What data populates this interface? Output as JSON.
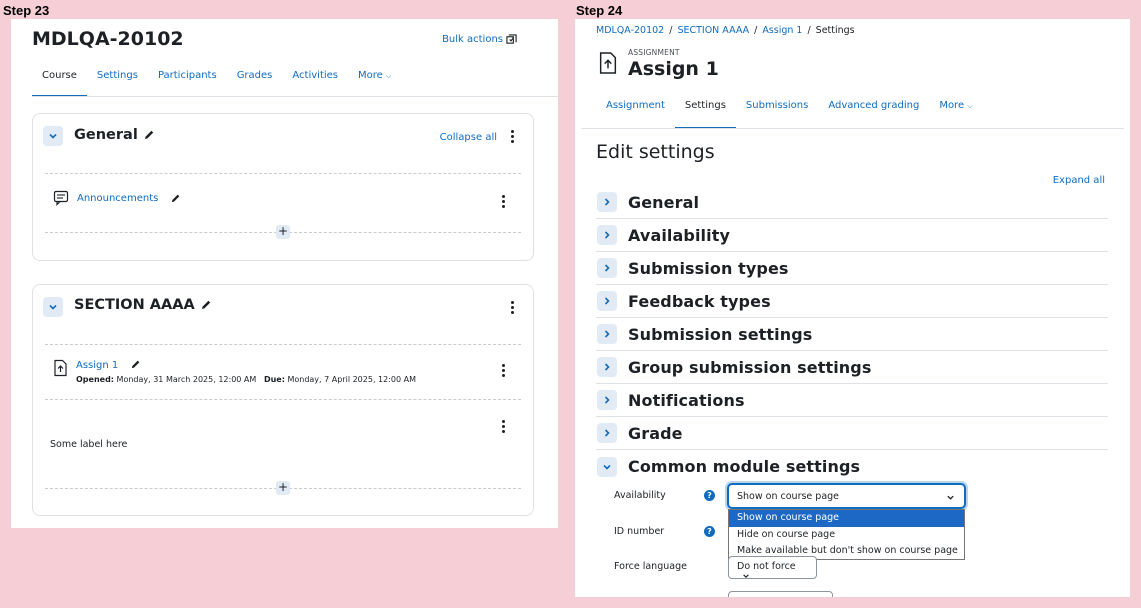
{
  "steps": {
    "left": "Step 23",
    "right": "Step 24"
  },
  "left": {
    "course_title": "MDLQA-20102",
    "bulk_actions": "Bulk actions",
    "tabs": [
      {
        "label": "Course",
        "active": true
      },
      {
        "label": "Settings",
        "active": false
      },
      {
        "label": "Participants",
        "active": false
      },
      {
        "label": "Grades",
        "active": false
      },
      {
        "label": "Activities",
        "active": false
      },
      {
        "label": "More",
        "active": false
      }
    ],
    "sections": [
      {
        "title": "General",
        "collapse_all": "Collapse all",
        "activities": [
          {
            "name": "Announcements",
            "icon": "forum-icon"
          }
        ]
      },
      {
        "title": "SECTION AAAA",
        "activities": [
          {
            "name": "Assign 1",
            "icon": "assignment-icon",
            "opened_label": "Opened:",
            "opened_value": "Monday, 31 March 2025, 12:00 AM",
            "due_label": "Due:",
            "due_value": "Monday, 7 April 2025, 12:00 AM"
          }
        ],
        "label_text": "Some label here"
      }
    ]
  },
  "right": {
    "breadcrumb": [
      "MDLQA-20102",
      "SECTION AAAA",
      "Assign 1",
      "Settings"
    ],
    "activity_kind": "ASSIGNMENT",
    "activity_title": "Assign 1",
    "tabs": [
      {
        "label": "Assignment",
        "active": false
      },
      {
        "label": "Settings",
        "active": true
      },
      {
        "label": "Submissions",
        "active": false
      },
      {
        "label": "Advanced grading",
        "active": false
      },
      {
        "label": "More",
        "active": false
      }
    ],
    "edit_title": "Edit settings",
    "expand_all": "Expand all",
    "fieldsets": [
      {
        "label": "General",
        "expanded": false
      },
      {
        "label": "Availability",
        "expanded": false
      },
      {
        "label": "Submission types",
        "expanded": false
      },
      {
        "label": "Feedback types",
        "expanded": false
      },
      {
        "label": "Submission settings",
        "expanded": false
      },
      {
        "label": "Group submission settings",
        "expanded": false
      },
      {
        "label": "Notifications",
        "expanded": false
      },
      {
        "label": "Grade",
        "expanded": false
      },
      {
        "label": "Common module settings",
        "expanded": true
      }
    ],
    "form": {
      "availability_label": "Availability",
      "availability_value": "Show on course page",
      "availability_options": [
        "Show on course page",
        "Hide on course page",
        "Make available but don't show on course page"
      ],
      "idnumber_label": "ID number",
      "force_language_label": "Force language",
      "force_language_value": "Do not force"
    },
    "colors": {
      "accent": "#0f6cbf",
      "selected_option": "#1e68c5"
    }
  }
}
